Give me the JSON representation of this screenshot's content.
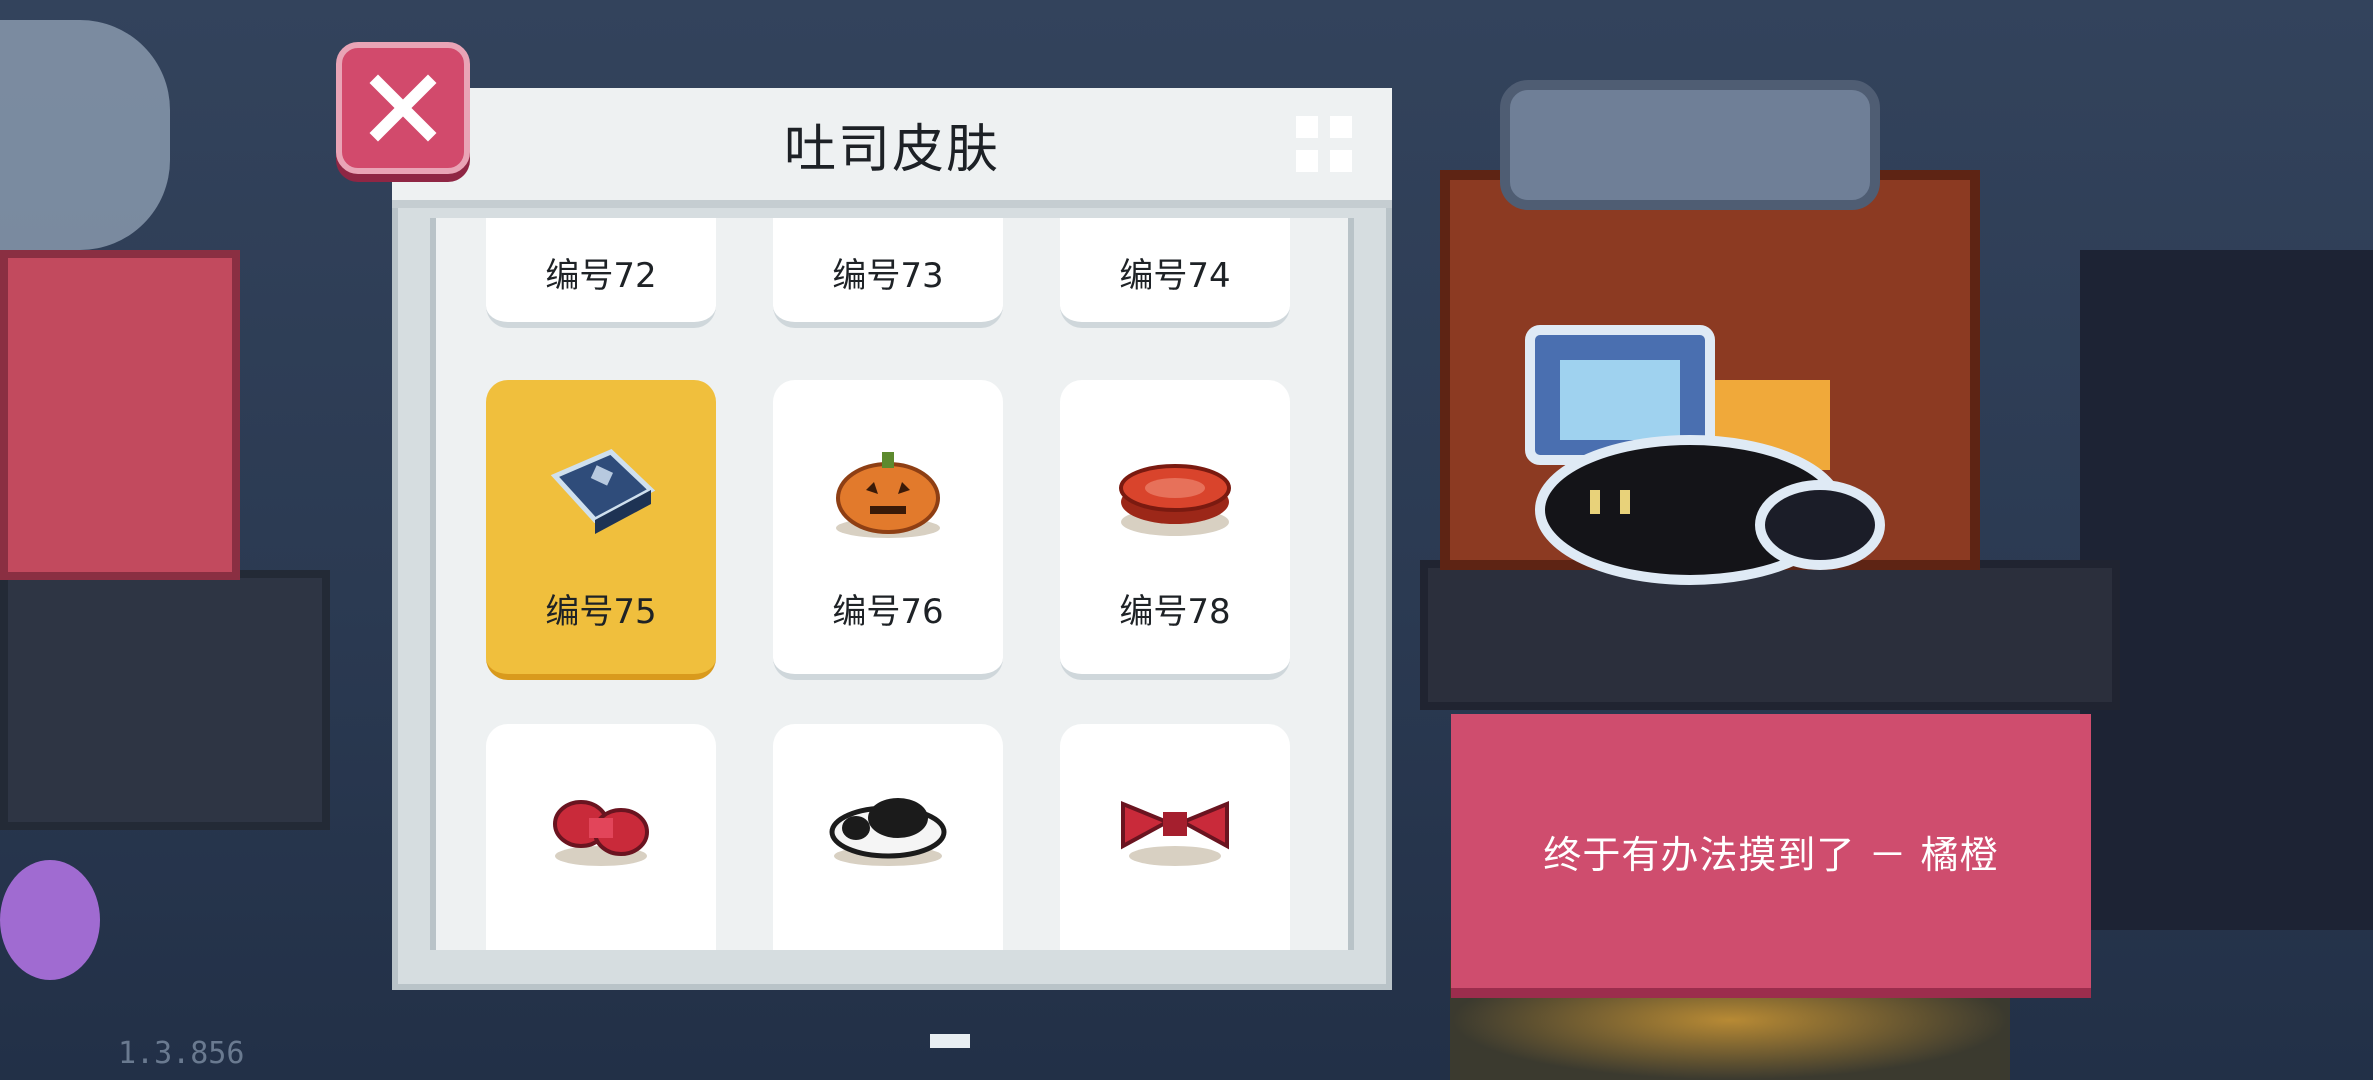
{
  "dialog": {
    "title": "吐司皮肤",
    "close_icon": "close-icon",
    "corner_icon": "grid-icon"
  },
  "skins": [
    {
      "label": "编号72",
      "icon": "",
      "selected": false,
      "partial": "top"
    },
    {
      "label": "编号73",
      "icon": "",
      "selected": false,
      "partial": "top"
    },
    {
      "label": "编号74",
      "icon": "",
      "selected": false,
      "partial": "top"
    },
    {
      "label": "编号75",
      "icon": "blue-book-toast-icon",
      "selected": true
    },
    {
      "label": "编号76",
      "icon": "pumpkin-toast-icon",
      "selected": false
    },
    {
      "label": "编号78",
      "icon": "mooncake-toast-icon",
      "selected": false
    },
    {
      "label": "",
      "icon": "red-bow-ribbon-icon",
      "selected": false,
      "partial": "bottom"
    },
    {
      "label": "",
      "icon": "black-white-cat-toast-icon",
      "selected": false,
      "partial": "bottom"
    },
    {
      "label": "",
      "icon": "red-bowtie-icon",
      "selected": false,
      "partial": "bottom"
    }
  ],
  "quote": {
    "text": "终于有办法摸到了 － 橘橙"
  },
  "version": "1.3.856",
  "colors": {
    "accent_pink": "#cf4d6e",
    "selected_yellow": "#f0bf3d",
    "panel_gray": "#eef1f2"
  }
}
